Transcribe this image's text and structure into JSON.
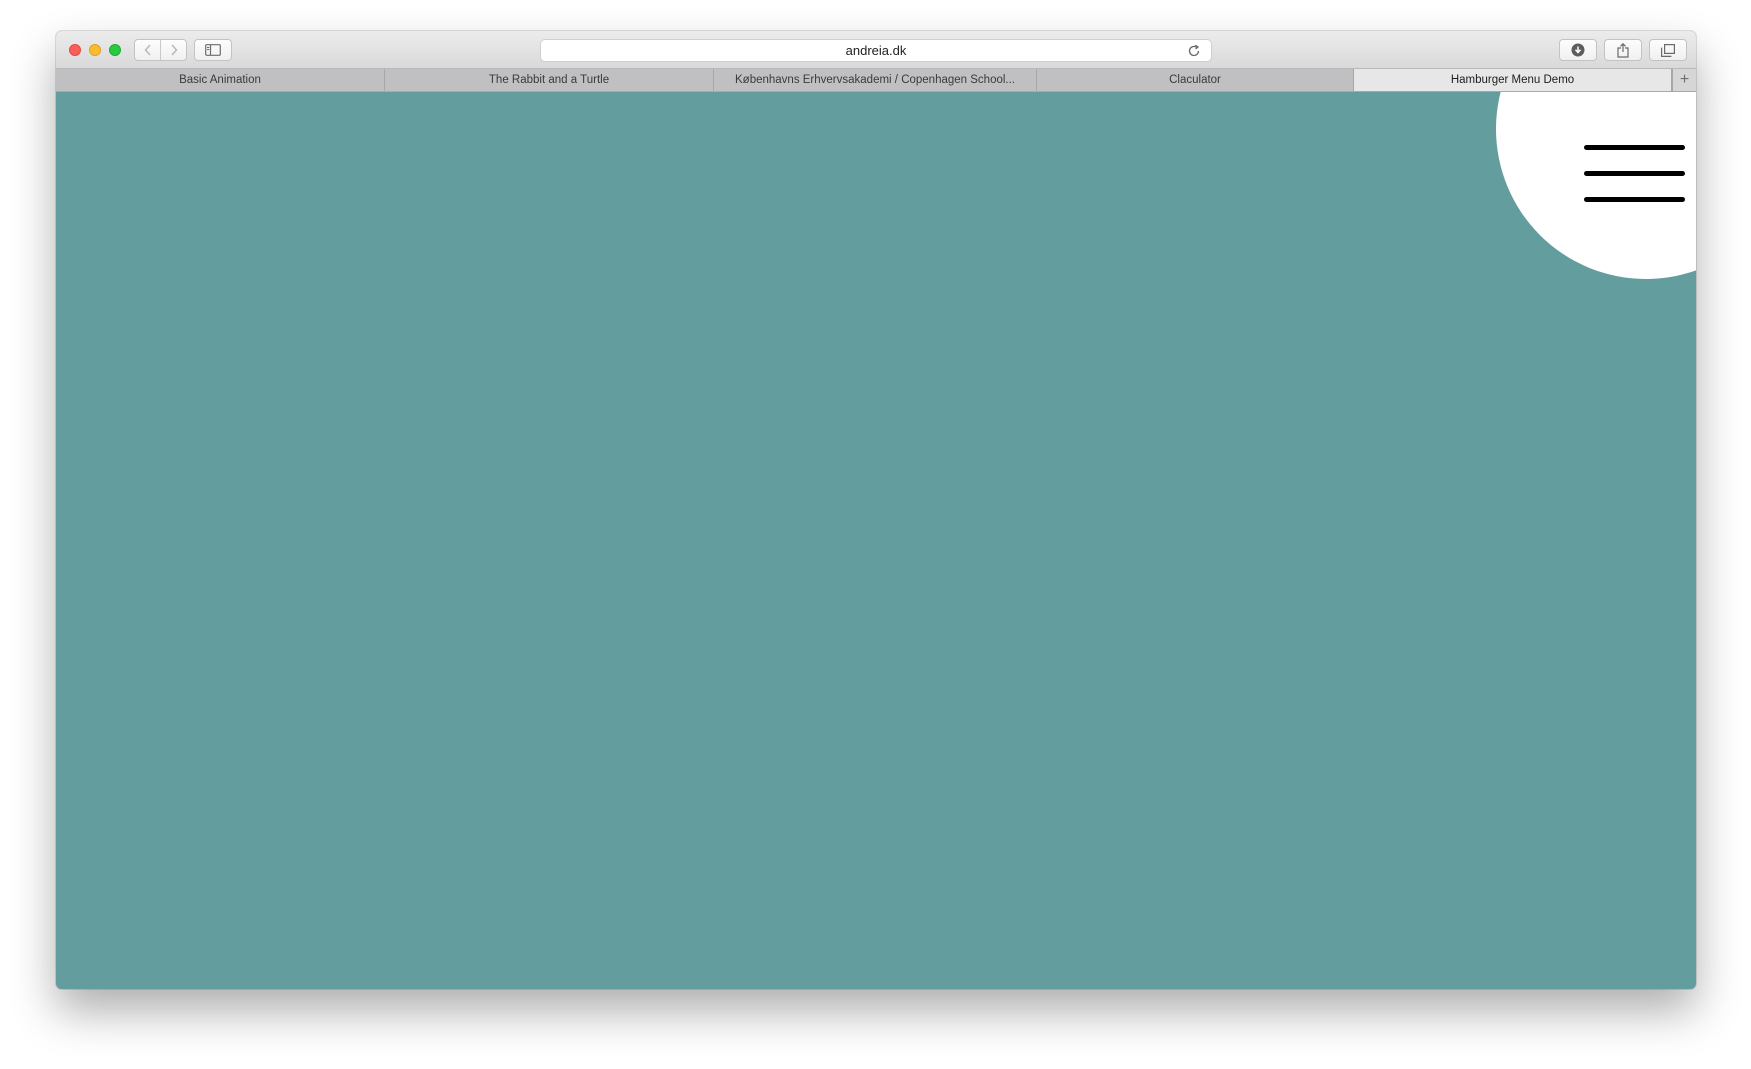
{
  "browser": {
    "url": "andreia.dk",
    "tabs": [
      {
        "label": "Basic Animation",
        "active": false
      },
      {
        "label": "The Rabbit and a Turtle",
        "active": false
      },
      {
        "label": "Københavns Erhvervsakademi / Copenhagen School...",
        "active": false
      },
      {
        "label": "Claculator",
        "active": false
      },
      {
        "label": "Hamburger Menu Demo",
        "active": true
      }
    ],
    "new_tab_symbol": "+"
  },
  "page": {
    "background_color": "#649d9e",
    "circle_color": "#ffffff",
    "hamburger_icon": "hamburger-menu-icon",
    "hamburger_color": "#000000"
  }
}
